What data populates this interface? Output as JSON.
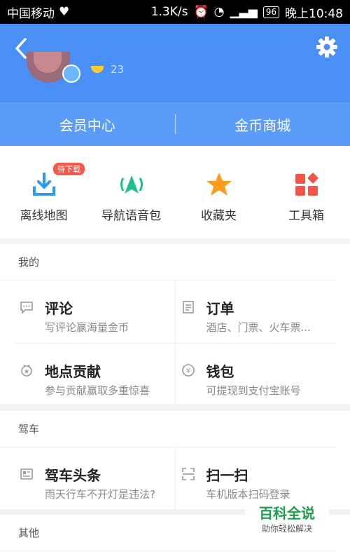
{
  "status_bar": {
    "carrier": "中国移动",
    "speed": "1.3K/s",
    "battery": "96",
    "time": "晚上10:48"
  },
  "header": {
    "level": "23"
  },
  "member_bar": {
    "member_center": "会员中心",
    "coin_mall": "金币商城"
  },
  "quick_actions": [
    {
      "label": "离线地图",
      "badge": "待下载",
      "icon": "download-icon",
      "color": "#2b9af3"
    },
    {
      "label": "导航语音包",
      "icon": "navigation-voice-icon",
      "color": "#19c28f"
    },
    {
      "label": "收藏夹",
      "icon": "star-icon",
      "color": "#ff9b1a"
    },
    {
      "label": "工具箱",
      "icon": "toolbox-icon",
      "color": "#f2564a"
    }
  ],
  "mine": {
    "title": "我的",
    "items": [
      {
        "title": "评论",
        "sub": "写评论赢海量金币",
        "icon": "comment-icon"
      },
      {
        "title": "订单",
        "sub": "酒店、门票、火车票...",
        "icon": "order-icon"
      },
      {
        "title": "地点贡献",
        "sub": "参与贡献赢取多重惊喜",
        "icon": "medal-icon"
      },
      {
        "title": "钱包",
        "sub": "可提现到支付宝账号",
        "icon": "wallet-icon"
      }
    ]
  },
  "drive": {
    "title": "驾车",
    "items": [
      {
        "title": "驾车头条",
        "sub": "雨天行车不开灯是违法?",
        "icon": "news-icon"
      },
      {
        "title": "扫一扫",
        "sub": "车机版本扫码登录",
        "icon": "scan-icon"
      }
    ]
  },
  "other": {
    "title": "其他"
  },
  "watermark": {
    "title": "百科全说",
    "sub": "助你轻松解决"
  }
}
